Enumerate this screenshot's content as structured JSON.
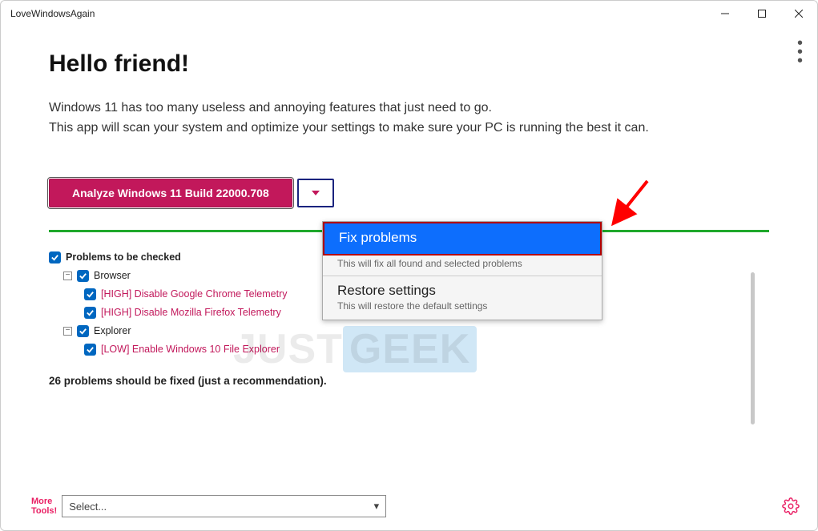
{
  "titlebar": {
    "title": "LoveWindowsAgain"
  },
  "header": {
    "title": "Hello friend!",
    "line1": "Windows 11 has too many useless and annoying features that just need to go.",
    "line2": "This app will scan your system and optimize your settings to make sure your PC is running the best it can."
  },
  "actions": {
    "analyze_label": "Analyze Windows 11 Build 22000.708"
  },
  "menu": {
    "items": [
      {
        "title": "Fix problems",
        "desc": "This will fix all found and selected problems"
      },
      {
        "title": "Restore settings",
        "desc": "This will restore the default settings"
      }
    ]
  },
  "tree": {
    "root_label": "Problems to be checked",
    "categories": [
      {
        "label": "Browser",
        "items": [
          {
            "label": "[HIGH] Disable Google Chrome Telemetry"
          },
          {
            "label": "[HIGH] Disable Mozilla Firefox Telemetry"
          }
        ]
      },
      {
        "label": "Explorer",
        "items": [
          {
            "label": "[LOW] Enable Windows 10 File Explorer"
          }
        ]
      }
    ],
    "summary": "26 problems should be fixed (just a recommendation)."
  },
  "footer": {
    "more_tools_line1": "More",
    "more_tools_line2": "Tools!",
    "select_placeholder": "Select..."
  }
}
